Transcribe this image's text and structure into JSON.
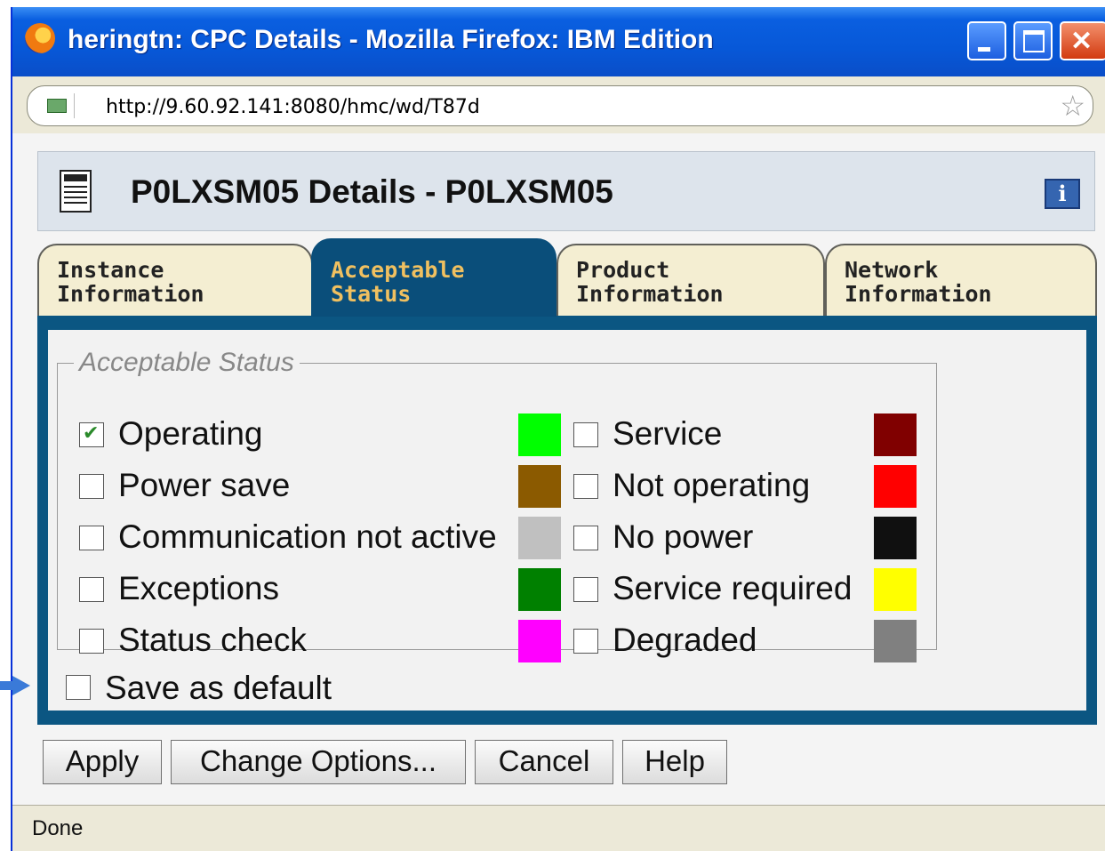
{
  "window": {
    "title": "heringtn: CPC Details - Mozilla Firefox: IBM Edition",
    "url": "http://9.60.92.141:8080/hmc/wd/T87d"
  },
  "header": {
    "title": "P0LXSM05 Details - P0LXSM05"
  },
  "tabs": [
    {
      "line1": "Instance",
      "line2": "Information"
    },
    {
      "line1": "Acceptable",
      "line2": "Status"
    },
    {
      "line1": "Product",
      "line2": "Information"
    },
    {
      "line1": "Network",
      "line2": "Information"
    }
  ],
  "active_tab": "Acceptable Status",
  "group": {
    "legend": "Acceptable Status",
    "left_items": [
      {
        "label": "Operating",
        "checked": true,
        "color": "#00ff00"
      },
      {
        "label": "Power save",
        "checked": false,
        "color": "#8b5a00"
      },
      {
        "label": "Communication not active",
        "checked": false,
        "color": "#c0c0c0"
      },
      {
        "label": "Exceptions",
        "checked": false,
        "color": "#008000"
      },
      {
        "label": "Status check",
        "checked": false,
        "color": "#ff00ff"
      }
    ],
    "right_items": [
      {
        "label": "Service",
        "checked": false,
        "color": "#800000"
      },
      {
        "label": "Not operating",
        "checked": false,
        "color": "#ff0000"
      },
      {
        "label": "No power",
        "checked": false,
        "color": "#101010"
      },
      {
        "label": "Service required",
        "checked": false,
        "color": "#ffff00"
      },
      {
        "label": "Degraded",
        "checked": false,
        "color": "#808080"
      }
    ]
  },
  "save_default": {
    "label": "Save as default",
    "checked": false
  },
  "buttons": {
    "apply": "Apply",
    "change_options": "Change Options...",
    "cancel": "Cancel",
    "help": "Help"
  },
  "status": "Done"
}
